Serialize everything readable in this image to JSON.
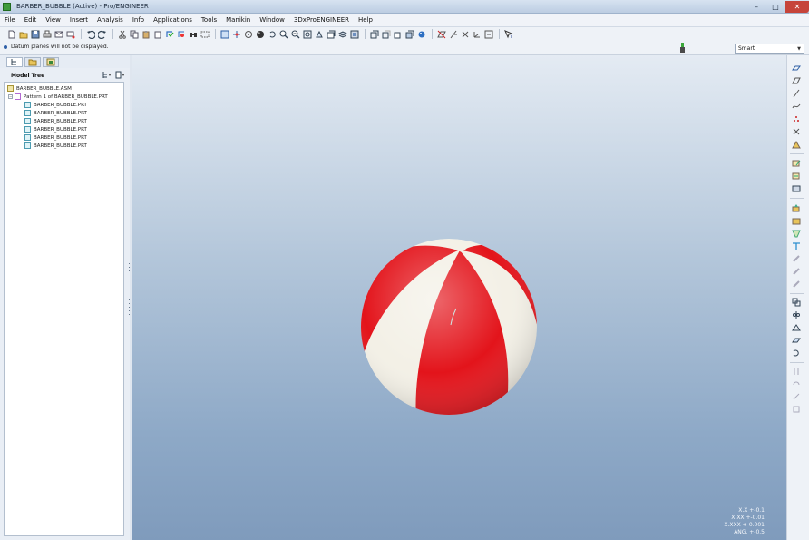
{
  "window": {
    "title": "BARBER_BUBBLE (Active) - Pro/ENGINEER",
    "minimize": "–",
    "maximize": "□",
    "close": "✕"
  },
  "menu": [
    "File",
    "Edit",
    "View",
    "Insert",
    "Analysis",
    "Info",
    "Applications",
    "Tools",
    "Manikin",
    "Window",
    "3DxProENGINEER",
    "Help"
  ],
  "message": {
    "text": "Datum planes will not be displayed."
  },
  "filter": {
    "selected": "Smart"
  },
  "navigator": {
    "tree_title": "Model Tree"
  },
  "model_tree": {
    "root": "BARBER_BUBBLE.ASM",
    "pattern": "Pattern 1 of BARBER_BUBBLE.PRT",
    "parts": [
      "BARBER_BUBBLE.PRT",
      "BARBER_BUBBLE.PRT",
      "BARBER_BUBBLE.PRT",
      "BARBER_BUBBLE.PRT",
      "BARBER_BUBBLE.PRT",
      "BARBER_BUBBLE.PRT"
    ]
  },
  "tolerances": {
    "x_x": "X.X +-0.1",
    "x_xx": "X.XX +-0.01",
    "x_xxx": "X.XXX +-0.001",
    "ang": "ANG. +-0.5"
  },
  "colors": {
    "ball_red": "#e3141b",
    "ball_white": "#f3f0e6",
    "viewport_top": "#e4ebf3",
    "viewport_bottom": "#7f9bbc"
  }
}
